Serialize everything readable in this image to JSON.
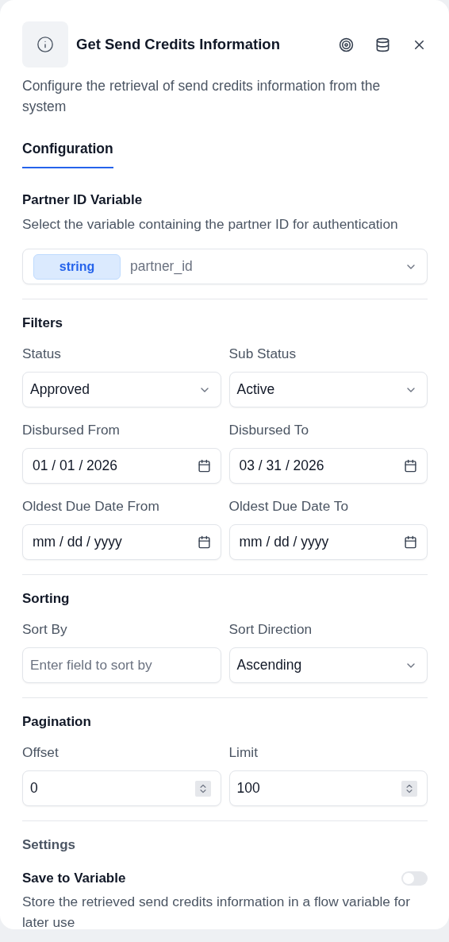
{
  "header": {
    "title": "Get Send Credits Information",
    "description": "Configure the retrieval of send credits information from the system"
  },
  "tabs": [
    {
      "label": "Configuration",
      "selected": true
    }
  ],
  "partner": {
    "heading": "Partner ID Variable",
    "hint": "Select the variable containing the partner ID for authentication",
    "type": "string",
    "value": "partner_id"
  },
  "sections": [
    {
      "title": "Filters",
      "fields": [
        {
          "kind": "select",
          "label": "Status",
          "value": "Approved"
        },
        {
          "kind": "select",
          "label": "Sub Status",
          "value": "Active"
        },
        {
          "kind": "date",
          "label": "Disbursed From",
          "value": "01 / 01 / 2026"
        },
        {
          "kind": "date",
          "label": "Disbursed To",
          "value": "03 / 31 / 2026"
        },
        {
          "kind": "date",
          "label": "Oldest Due Date From",
          "value": "mm / dd / yyyy"
        },
        {
          "kind": "date",
          "label": "Oldest Due Date To",
          "value": "mm / dd / yyyy"
        }
      ]
    },
    {
      "title": "Sorting",
      "fields": [
        {
          "kind": "text",
          "label": "Sort By",
          "placeholder": "Enter field to sort by"
        },
        {
          "kind": "select",
          "label": "Sort Direction",
          "value": "Ascending"
        }
      ]
    },
    {
      "title": "Pagination",
      "fields": [
        {
          "kind": "number",
          "label": "Offset",
          "value": "0"
        },
        {
          "kind": "number",
          "label": "Limit",
          "value": "100"
        }
      ]
    }
  ],
  "settings": {
    "title": "Settings",
    "toggle_label": "Save to Variable",
    "on": false,
    "description": "Store the retrieved send credits information in a flow variable for later use"
  }
}
